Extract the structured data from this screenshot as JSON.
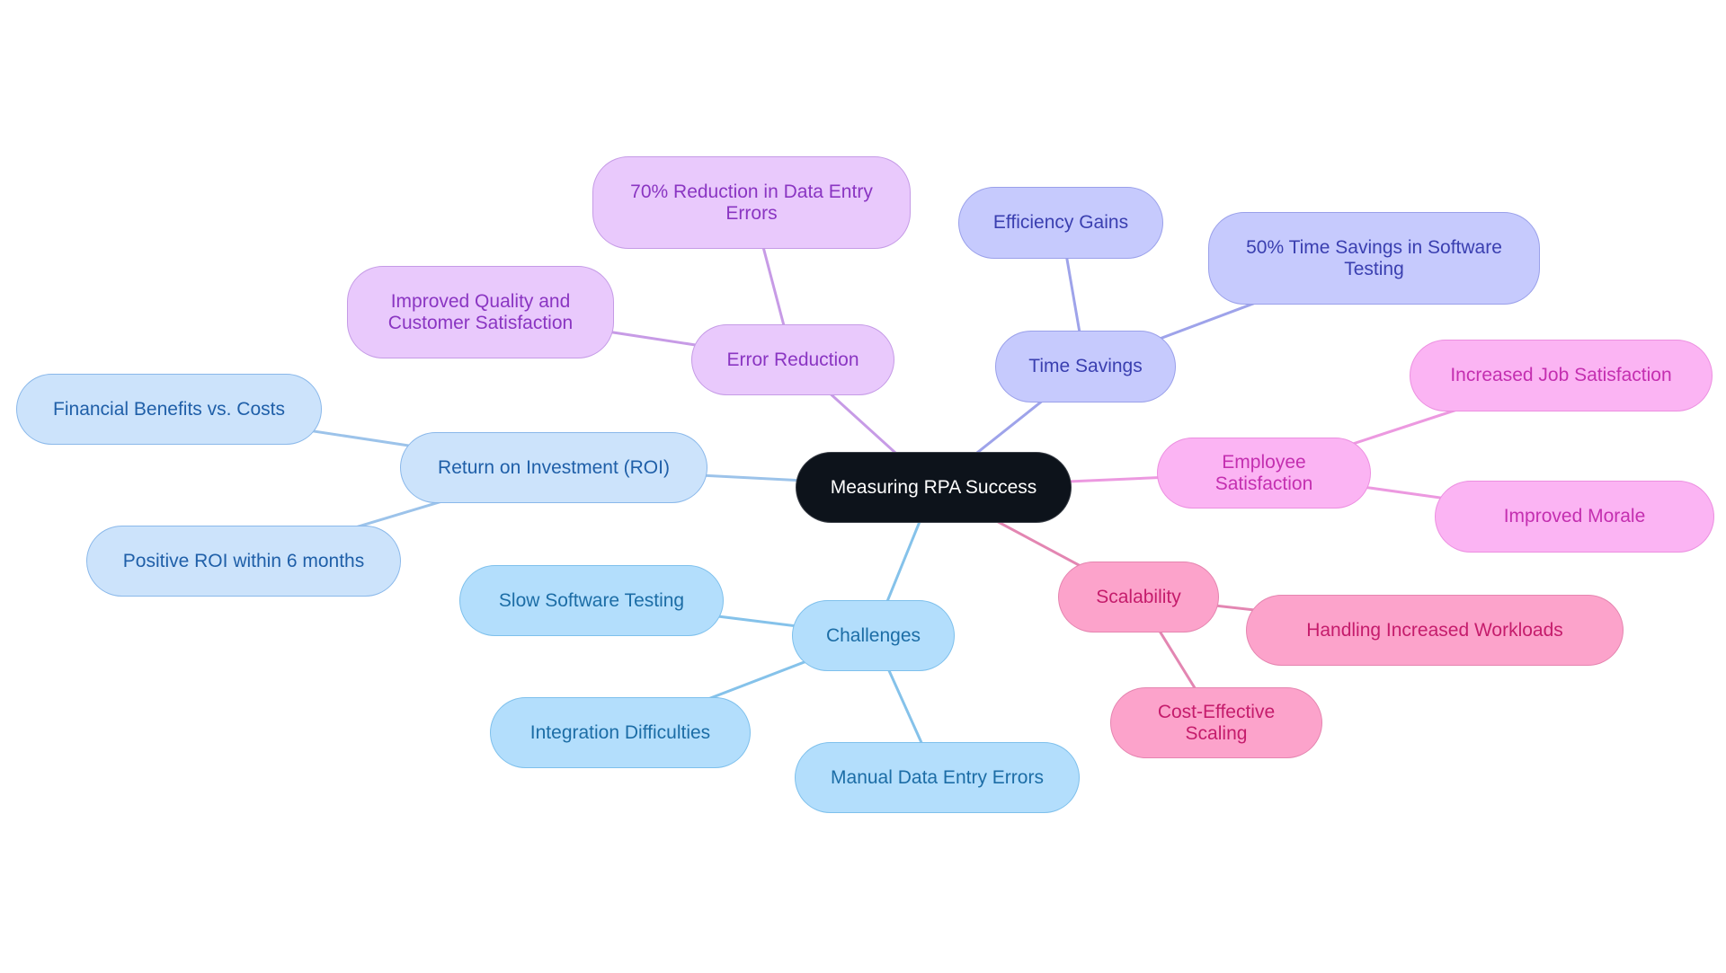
{
  "root": {
    "label": "Measuring RPA Success",
    "color": "#0d131b"
  },
  "branches": [
    {
      "key": "roi",
      "label": "Return on Investment (ROI)",
      "line_color": "#9cc3ea",
      "children": [
        "Financial Benefits vs. Costs",
        "Positive ROI within 6 months"
      ]
    },
    {
      "key": "err",
      "label": "Error Reduction",
      "line_color": "#c79be6",
      "children": [
        "70% Reduction in Data Entry Errors",
        "Improved Quality and Customer Satisfaction"
      ]
    },
    {
      "key": "time",
      "label": "Time Savings",
      "line_color": "#9ea3ea",
      "children": [
        "Efficiency Gains",
        "50% Time Savings in Software Testing"
      ]
    },
    {
      "key": "emp",
      "label": "Employee Satisfaction",
      "line_color": "#ec99e0",
      "children": [
        "Increased Job Satisfaction",
        "Improved Morale"
      ]
    },
    {
      "key": "scal",
      "label": "Scalability",
      "line_color": "#e386b2",
      "children": [
        "Handling Increased Workloads",
        "Cost-Effective Scaling"
      ]
    },
    {
      "key": "chal",
      "label": "Challenges",
      "line_color": "#85c2ea",
      "children": [
        "Slow Software Testing",
        "Integration Difficulties",
        "Manual Data Entry Errors"
      ]
    }
  ]
}
